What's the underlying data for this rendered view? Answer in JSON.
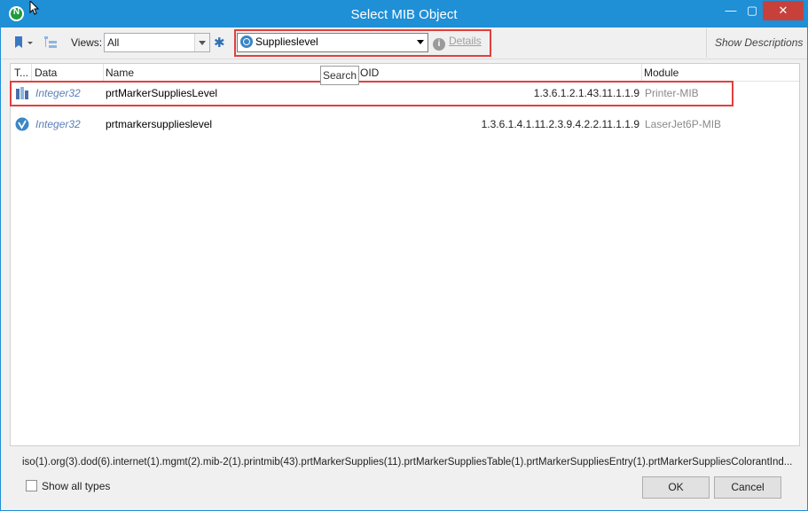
{
  "window": {
    "title": "Select MIB Object",
    "minimize": "—",
    "maximize": "▢",
    "close": "✕"
  },
  "toolbar": {
    "views_label": "Views:",
    "views_value": "All",
    "search_value": "Supplieslevel",
    "details_label": "Details",
    "show_descriptions_label": "Show Descriptions",
    "tooltip": "Search"
  },
  "table": {
    "columns": [
      "T...",
      "Data",
      "Name",
      "OID",
      "Module"
    ],
    "rows": [
      {
        "type_icon": "bar-chart-icon",
        "data": "Integer32",
        "name": "prtMarkerSuppliesLevel",
        "oid": "1.3.6.1.2.1.43.11.1.1.9",
        "module": "Printer-MIB"
      },
      {
        "type_icon": "check-circle-icon",
        "data": "Integer32",
        "name": "prtmarkersupplieslevel",
        "oid": "1.3.6.1.4.1.11.2.3.9.4.2.2.11.1.1.9",
        "module": "LaserJet6P-MIB"
      }
    ]
  },
  "footer": {
    "path": "iso(1).org(3).dod(6).internet(1).mgmt(2).mib-2(1).printmib(43).prtMarkerSupplies(11).prtMarkerSuppliesTable(1).prtMarkerSuppliesEntry(1).prtMarkerSuppliesColorantInd...",
    "show_all_types": "Show all types",
    "ok": "OK",
    "cancel": "Cancel"
  },
  "colors": {
    "titlebar": "#1f8fd6",
    "highlight": "#e0403e",
    "close_button": "#c7413a"
  }
}
